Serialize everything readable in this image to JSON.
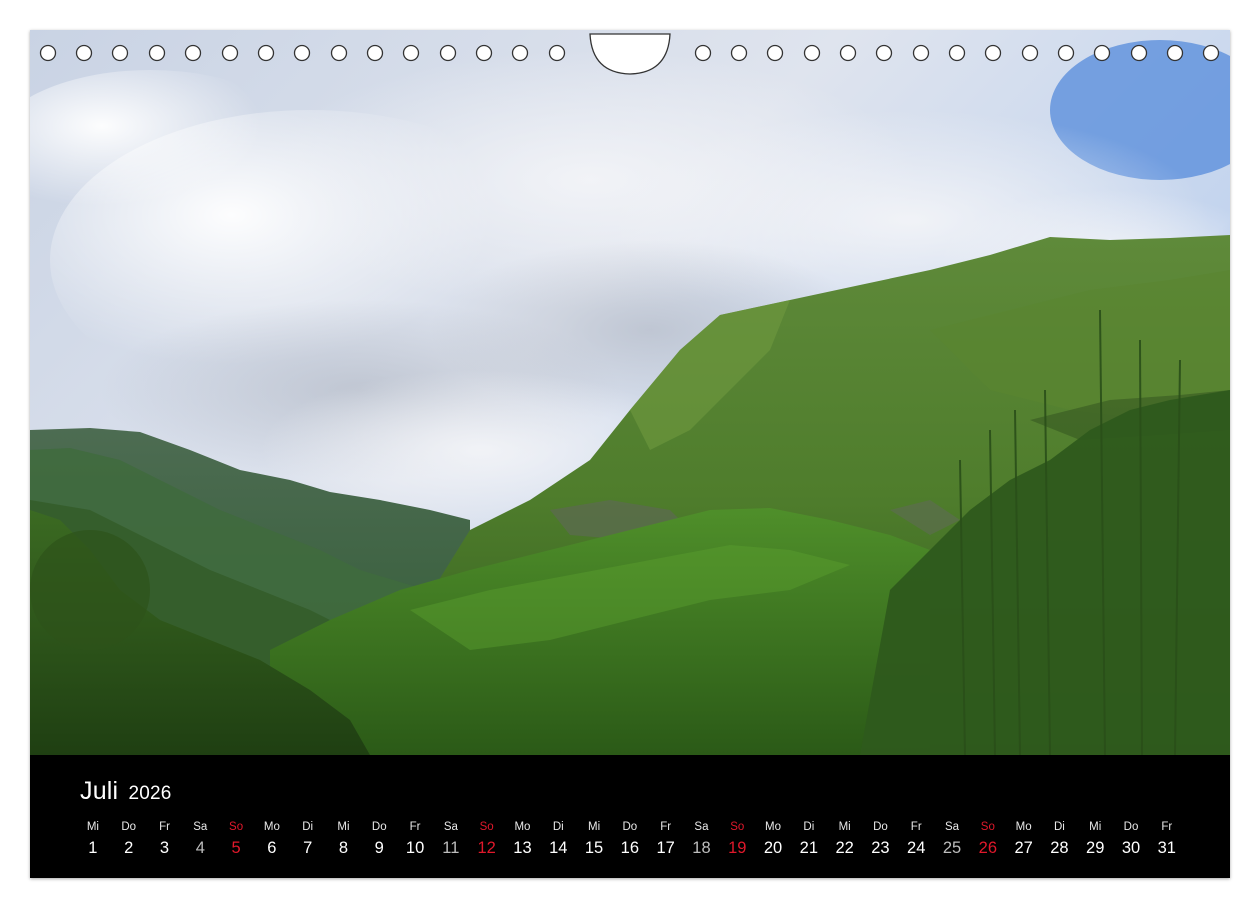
{
  "calendar": {
    "month": "Juli",
    "year": "2026",
    "weekend_color_sunday": "#e0182b",
    "days": [
      {
        "wd": "Mi",
        "num": "1",
        "type": "weekday"
      },
      {
        "wd": "Do",
        "num": "2",
        "type": "weekday"
      },
      {
        "wd": "Fr",
        "num": "3",
        "type": "weekday"
      },
      {
        "wd": "Sa",
        "num": "4",
        "type": "sat"
      },
      {
        "wd": "So",
        "num": "5",
        "type": "sun"
      },
      {
        "wd": "Mo",
        "num": "6",
        "type": "weekday"
      },
      {
        "wd": "Di",
        "num": "7",
        "type": "weekday"
      },
      {
        "wd": "Mi",
        "num": "8",
        "type": "weekday"
      },
      {
        "wd": "Do",
        "num": "9",
        "type": "weekday"
      },
      {
        "wd": "Fr",
        "num": "10",
        "type": "weekday"
      },
      {
        "wd": "Sa",
        "num": "11",
        "type": "sat"
      },
      {
        "wd": "So",
        "num": "12",
        "type": "sun"
      },
      {
        "wd": "Mo",
        "num": "13",
        "type": "weekday"
      },
      {
        "wd": "Di",
        "num": "14",
        "type": "weekday"
      },
      {
        "wd": "Mi",
        "num": "15",
        "type": "weekday"
      },
      {
        "wd": "Do",
        "num": "16",
        "type": "weekday"
      },
      {
        "wd": "Fr",
        "num": "17",
        "type": "weekday"
      },
      {
        "wd": "Sa",
        "num": "18",
        "type": "sat"
      },
      {
        "wd": "So",
        "num": "19",
        "type": "sun"
      },
      {
        "wd": "Mo",
        "num": "20",
        "type": "weekday"
      },
      {
        "wd": "Di",
        "num": "21",
        "type": "weekday"
      },
      {
        "wd": "Mi",
        "num": "22",
        "type": "weekday"
      },
      {
        "wd": "Do",
        "num": "23",
        "type": "weekday"
      },
      {
        "wd": "Fr",
        "num": "24",
        "type": "weekday"
      },
      {
        "wd": "Sa",
        "num": "25",
        "type": "sat"
      },
      {
        "wd": "So",
        "num": "26",
        "type": "sun"
      },
      {
        "wd": "Mo",
        "num": "27",
        "type": "weekday"
      },
      {
        "wd": "Di",
        "num": "28",
        "type": "weekday"
      },
      {
        "wd": "Mi",
        "num": "29",
        "type": "weekday"
      },
      {
        "wd": "Do",
        "num": "30",
        "type": "weekday"
      },
      {
        "wd": "Fr",
        "num": "31",
        "type": "weekday"
      }
    ]
  },
  "photo": {
    "subject": "mountain-valley-landscape"
  }
}
